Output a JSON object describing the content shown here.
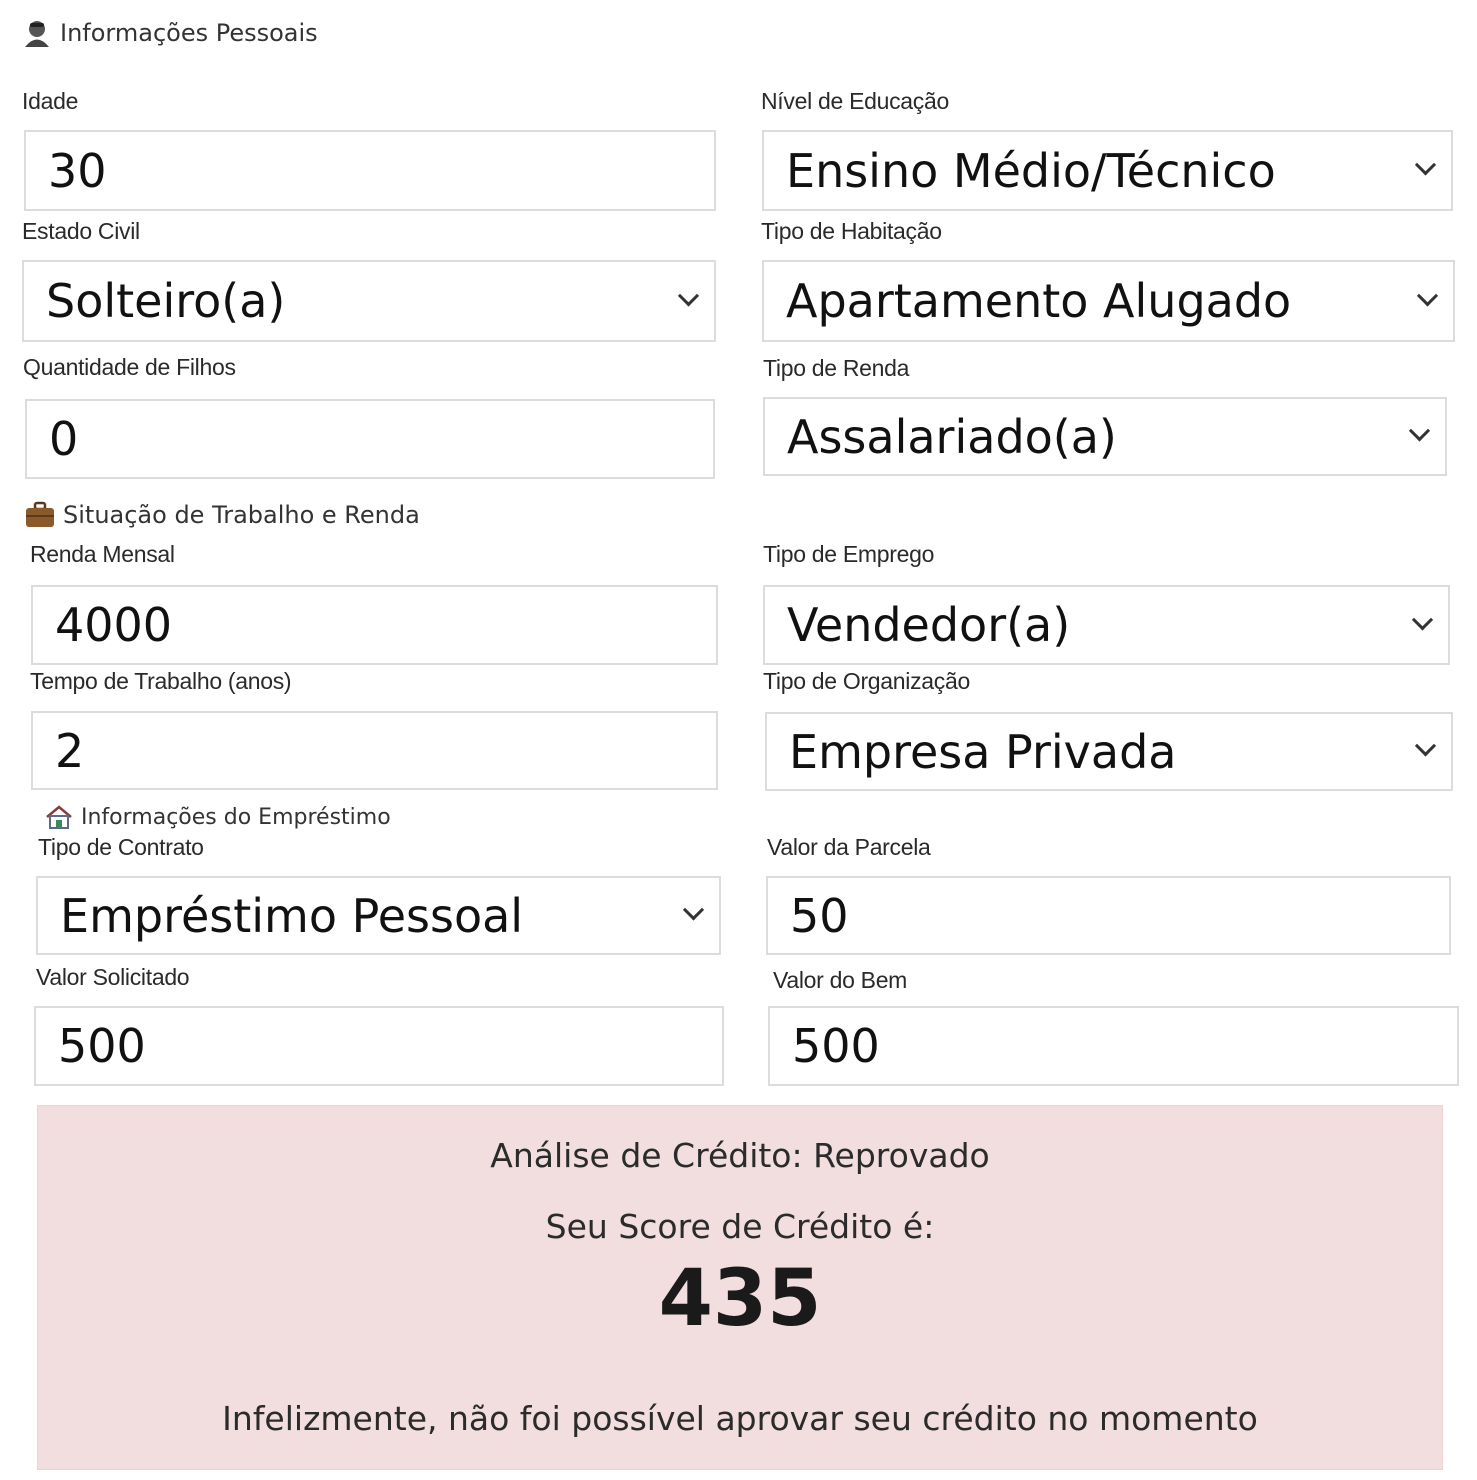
{
  "sections": {
    "personal": {
      "icon": "person-icon",
      "title": "Informações Pessoais"
    },
    "work": {
      "icon": "briefcase-icon",
      "title": "Situação de Trabalho e Renda"
    },
    "loan": {
      "icon": "house-icon",
      "title": "Informações do Empréstimo"
    }
  },
  "fields": {
    "idade": {
      "label": "Idade",
      "value": "30"
    },
    "nivel_educacao": {
      "label": "Nível de Educação",
      "value": "Ensino Médio/Técnico"
    },
    "estado_civil": {
      "label": "Estado Civil",
      "value": "Solteiro(a)"
    },
    "tipo_habitacao": {
      "label": "Tipo de Habitação",
      "value": "Apartamento Alugado"
    },
    "quantidade_filhos": {
      "label": "Quantidade de Filhos",
      "value": "0"
    },
    "tipo_renda": {
      "label": "Tipo de Renda",
      "value": "Assalariado(a)"
    },
    "renda_mensal": {
      "label": "Renda Mensal",
      "value": "4000"
    },
    "tipo_emprego": {
      "label": "Tipo de Emprego",
      "value": "Vendedor(a)"
    },
    "tempo_trabalho": {
      "label": "Tempo de Trabalho (anos)",
      "value": "2"
    },
    "tipo_organizacao": {
      "label": "Tipo de Organização",
      "value": "Empresa Privada"
    },
    "tipo_contrato": {
      "label": "Tipo de Contrato",
      "value": "Empréstimo Pessoal"
    },
    "valor_parcela": {
      "label": "Valor da Parcela",
      "value": "50"
    },
    "valor_solicitado": {
      "label": "Valor Solicitado",
      "value": "500"
    },
    "valor_bem": {
      "label": "Valor do Bem",
      "value": "500"
    }
  },
  "result": {
    "status_line": "Análise de Crédito: Reprovado",
    "score_label": "Seu Score de Crédito é:",
    "score": "435",
    "message": "Infelizmente, não foi possível aprovar seu crédito no momento",
    "background_color": "#f2dedf"
  }
}
